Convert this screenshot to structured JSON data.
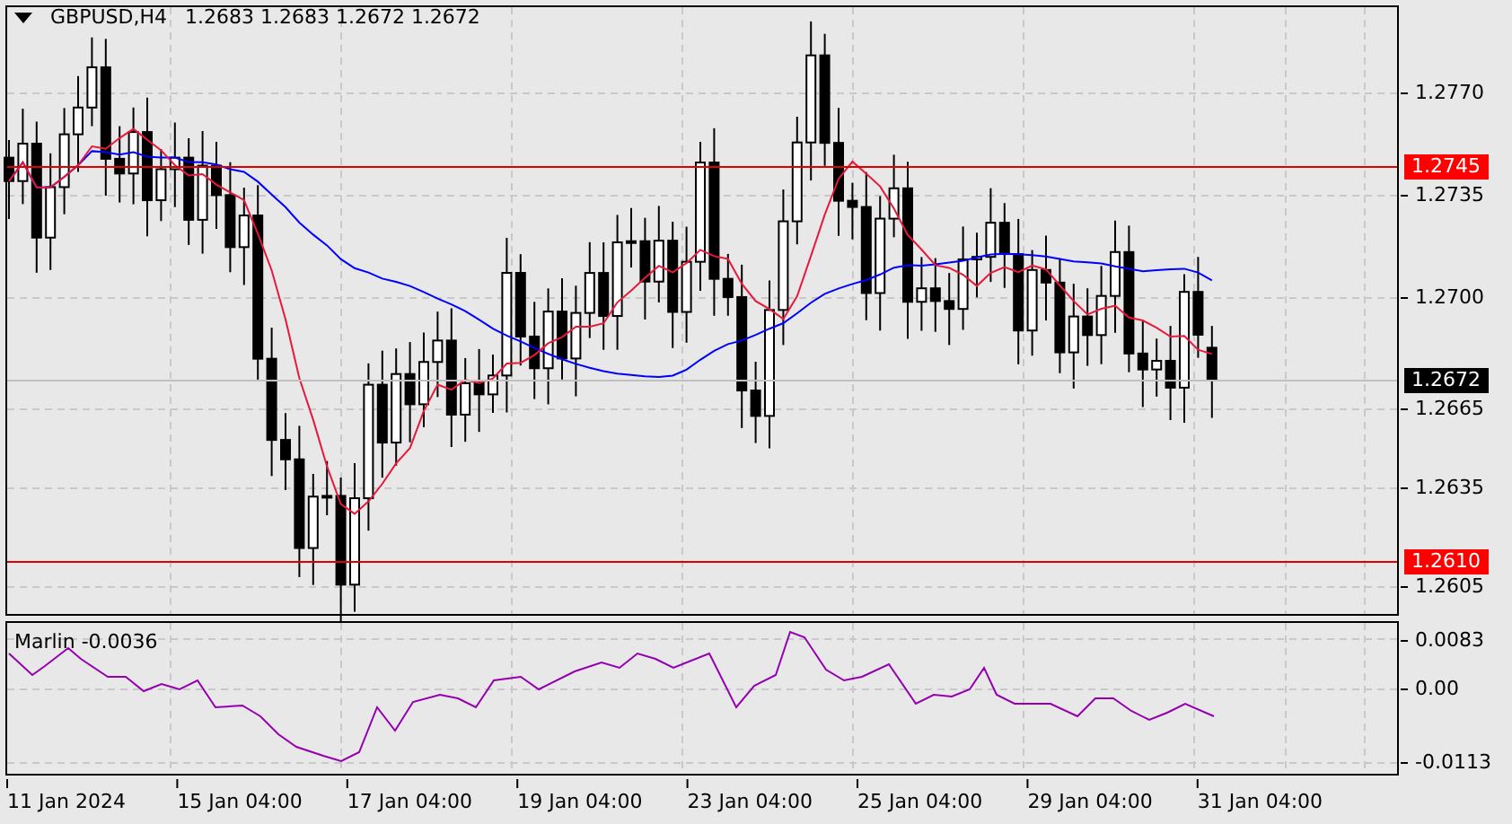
{
  "header": {
    "symbol": "GBPUSD,H4",
    "quote": "1.2683 1.2683 1.2672 1.2672"
  },
  "price_axis": {
    "ticks": [
      "1.2770",
      "1.2735",
      "1.2700",
      "1.2665",
      "1.2635",
      "1.2605"
    ]
  },
  "price_lines": [
    {
      "label": "1.2745",
      "kind": "level"
    },
    {
      "label": "1.2672",
      "kind": "current"
    },
    {
      "label": "1.2610",
      "kind": "level"
    }
  ],
  "indicator": {
    "label": "Marlin -0.0036",
    "ticks": [
      "0.0083",
      "0.00",
      "-0.0113"
    ]
  },
  "time_axis": [
    "11 Jan 2024",
    "15 Jan 04:00",
    "17 Jan 04:00",
    "19 Jan 04:00",
    "23 Jan 04:00",
    "25 Jan 04:00",
    "29 Jan 04:00",
    "31 Jan 04:00"
  ]
}
